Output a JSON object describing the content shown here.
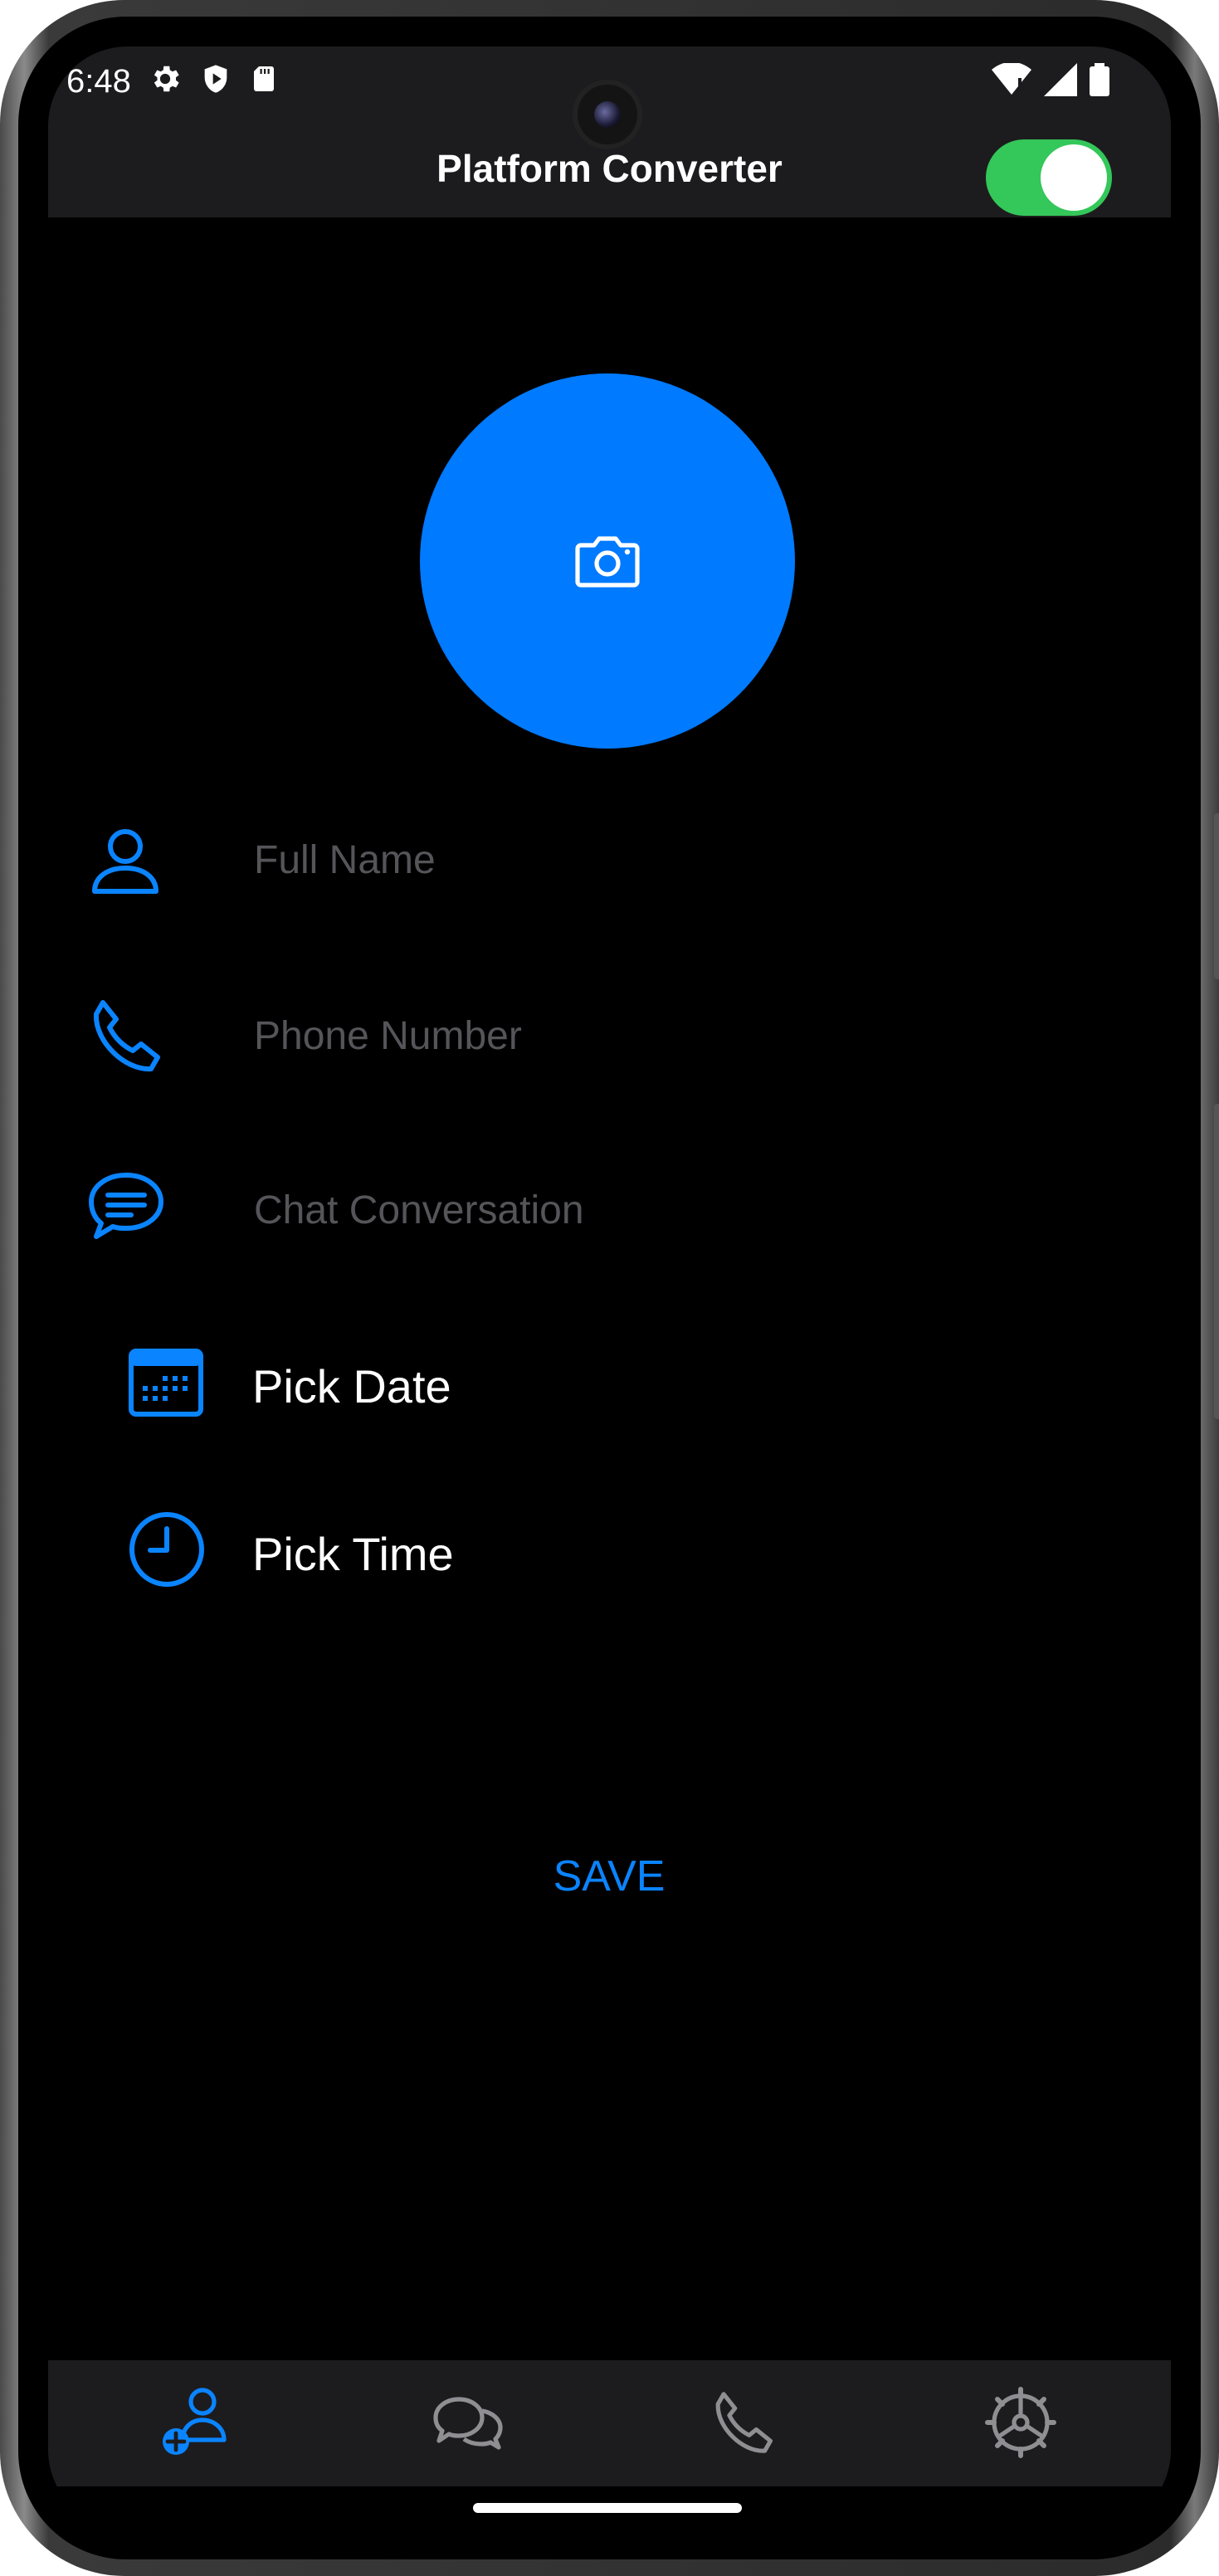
{
  "status_bar": {
    "time": "6:48",
    "left_icons": [
      "gear-icon",
      "shield-play-icon",
      "sd-card-icon"
    ],
    "right_icons": [
      "wifi-icon",
      "signal-icon",
      "battery-icon"
    ]
  },
  "header": {
    "title": "Platform Converter",
    "toggle_on": true,
    "toggle_color": "#34c759"
  },
  "avatar": {
    "icon": "camera-icon",
    "color": "#007aff"
  },
  "form": {
    "full_name_placeholder": "Full Name",
    "phone_placeholder": "Phone Number",
    "chat_placeholder": "Chat Conversation",
    "pick_date_label": "Pick Date",
    "pick_time_label": "Pick Time",
    "save_label": "SAVE"
  },
  "tabs": [
    {
      "icon": "add-contact-icon",
      "active": true
    },
    {
      "icon": "chats-icon",
      "active": false
    },
    {
      "icon": "phone-icon",
      "active": false
    },
    {
      "icon": "settings-icon",
      "active": false
    }
  ],
  "colors": {
    "accent": "#0a84ff",
    "inactive_tab": "#8e8e93",
    "placeholder": "#555559"
  }
}
